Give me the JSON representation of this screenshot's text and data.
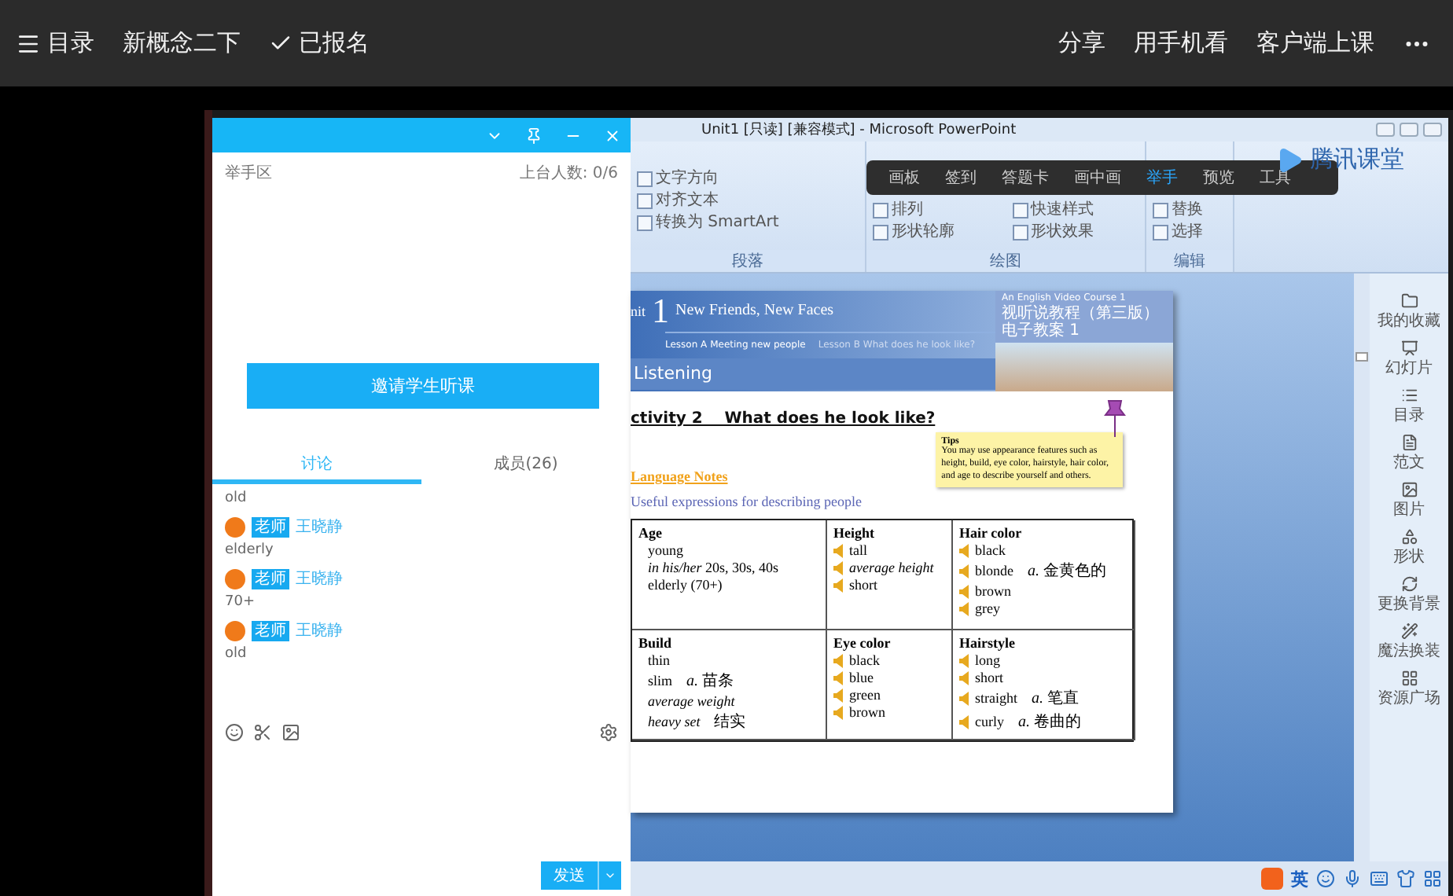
{
  "top_bar": {
    "left": [
      {
        "kind": "menu",
        "label": "目录"
      },
      {
        "kind": "plain",
        "label": "新概念二下"
      },
      {
        "kind": "check",
        "label": "已报名"
      }
    ],
    "right": [
      {
        "kind": "plain",
        "label": "分享"
      },
      {
        "kind": "plain",
        "label": "用手机看"
      },
      {
        "kind": "plain",
        "label": "客户端上课"
      },
      {
        "kind": "more"
      }
    ]
  },
  "chat_panel": {
    "hand_raise": {
      "title": "举手区",
      "count": "上台人数: 0/6"
    },
    "invite_button": "邀请学生听课",
    "tabs": [
      {
        "label": "讨论",
        "selected": true
      },
      {
        "label": "成员(26)",
        "selected": false
      }
    ],
    "messages": [
      {
        "kind": "continued",
        "text": "old"
      },
      {
        "kind": "full",
        "badge": "老师",
        "author": "王晓静",
        "text": "elderly"
      },
      {
        "kind": "full",
        "badge": "老师",
        "author": "王晓静",
        "text": "70+"
      },
      {
        "kind": "full",
        "badge": "老师",
        "author": "王晓静",
        "text": "old"
      }
    ],
    "send_button": "发送"
  },
  "powerpoint": {
    "title": "Unit1 [只读] [兼容模式] - Microsoft PowerPoint",
    "ribbon_groups": [
      {
        "label": "段落",
        "items": [
          "文字方向",
          "对齐文本",
          "转换为 SmartArt"
        ]
      },
      {
        "label": "绘图",
        "items": [
          "排列",
          "快速样式",
          "形状轮廓",
          "形状效果"
        ]
      },
      {
        "label": "编辑",
        "items": [
          "替换",
          "选择"
        ]
      }
    ],
    "classroom_toolbar": [
      {
        "label": "画板",
        "selected": false
      },
      {
        "label": "签到",
        "selected": false
      },
      {
        "label": "答题卡",
        "selected": false
      },
      {
        "label": "画中画",
        "selected": false
      },
      {
        "label": "举手",
        "selected": true
      },
      {
        "label": "预览",
        "selected": false
      },
      {
        "label": "工具",
        "selected": false
      }
    ],
    "logo": "腾讯课堂",
    "slide": {
      "unit_label": "nit",
      "unit_number": "1",
      "unit_title": "New Friends, New Faces",
      "lessons": [
        "Lesson A  Meeting new people",
        "Lesson B  What does he look like?"
      ],
      "section": "Listening",
      "course": [
        "An English Video Course 1",
        "视听说教程（第三版）电子教案 1"
      ],
      "activity": "ctivity 2    What does he look like?",
      "tips": {
        "title": "Tips",
        "body": "You may use appearance features such as height, build, eye color, hairstyle, hair color, and age to describe yourself and others."
      },
      "notes_title": "Language Notes",
      "notes_subtitle": "Useful expressions for describing people",
      "table": [
        {
          "heading": "Age",
          "audio": false,
          "items": [
            {
              "text": "young",
              "italic": false
            },
            {
              "text": "*in his/her* 20s, 30s, 40s",
              "italic": false
            },
            {
              "text": "elderly (70+)",
              "italic": false
            }
          ]
        },
        {
          "heading": "Height",
          "audio": true,
          "items": [
            {
              "text": "tall",
              "italic": false
            },
            {
              "text": "average height",
              "italic": true
            },
            {
              "text": "short",
              "italic": false
            }
          ]
        },
        {
          "heading": "Hair color",
          "audio": true,
          "items": [
            {
              "text": "black",
              "italic": false
            },
            {
              "text": "blonde",
              "italic": false,
              "gloss": "*a.* 金黄色的"
            },
            {
              "text": "brown",
              "italic": false
            },
            {
              "text": "grey",
              "italic": false
            }
          ]
        },
        {
          "heading": "Build",
          "audio": false,
          "items": [
            {
              "text": "thin",
              "italic": false
            },
            {
              "text": "slim",
              "italic": false,
              "gloss": "*a.* 苗条"
            },
            {
              "text": "average weight",
              "italic": true
            },
            {
              "text": "heavy set",
              "italic": true,
              "gloss": "结实"
            }
          ]
        },
        {
          "heading": "Eye color",
          "audio": true,
          "items": [
            {
              "text": "black",
              "italic": false
            },
            {
              "text": "blue",
              "italic": false
            },
            {
              "text": "green",
              "italic": false
            },
            {
              "text": "brown",
              "italic": false
            }
          ]
        },
        {
          "heading": "Hairstyle",
          "audio": true,
          "items": [
            {
              "text": "long",
              "italic": false
            },
            {
              "text": "short",
              "italic": false
            },
            {
              "text": "straight",
              "italic": false,
              "gloss": "*a.* 笔直"
            },
            {
              "text": "curly",
              "italic": false,
              "gloss": "*a.* 卷曲的"
            }
          ]
        }
      ]
    },
    "side_panel": [
      "我的收藏",
      "幻灯片",
      "目录",
      "范文",
      "图片",
      "形状",
      "更换背景",
      "魔法换装",
      "资源广场"
    ],
    "status_bar": {
      "ime": "英"
    }
  }
}
